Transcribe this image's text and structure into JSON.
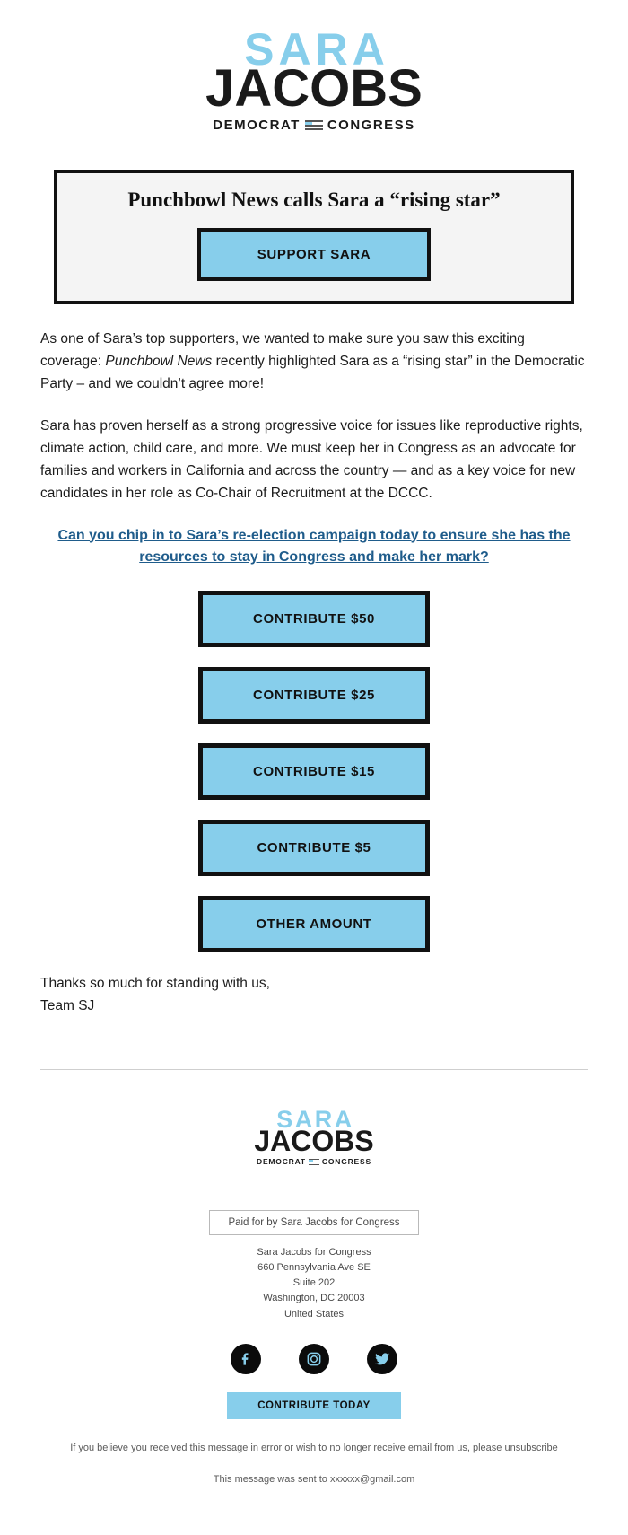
{
  "logo": {
    "first_name": "SARA",
    "last_name": "JACOBS",
    "tagline_left": "DEMOCRAT",
    "tagline_right": "CONGRESS",
    "icon": "flag-mark-icon",
    "accent_color": "#87CEEB",
    "dark_color": "#1a1a1a"
  },
  "hero": {
    "headline": "Punchbowl News calls Sara a “rising star”",
    "cta_label": "SUPPORT SARA"
  },
  "body": {
    "paragraph1_part1": "As one of Sara’s top supporters, we wanted to make sure you saw this exciting coverage: ",
    "paragraph1_italic": "Punchbowl News",
    "paragraph1_part2": " recently highlighted Sara as a “rising star” in the Democratic Party – and we couldn’t agree more!",
    "paragraph2": "Sara has proven herself as a strong progressive voice for issues like reproductive rights, climate action, child care, and more. We must keep her in Congress as an advocate for families and workers in California and across the country — and as a key voice for new candidates in her role as Co-Chair of Recruitment at the DCCC.",
    "cta_link": "Can you chip in to Sara’s re-election campaign today to ensure she has the resources to stay in Congress and make her mark?",
    "signoff_line1": "Thanks so much for standing with us,",
    "signoff_line2": "Team SJ"
  },
  "donate_buttons": [
    {
      "label": "CONTRIBUTE $50"
    },
    {
      "label": "CONTRIBUTE $25"
    },
    {
      "label": "CONTRIBUTE $15"
    },
    {
      "label": "CONTRIBUTE $5"
    },
    {
      "label": "OTHER AMOUNT"
    }
  ],
  "footer": {
    "paid_for": "Paid for by Sara Jacobs for Congress",
    "address": {
      "org": "Sara Jacobs for Congress",
      "street": "660 Pennsylvania Ave SE",
      "suite": "Suite 202",
      "city_state_zip": "Washington, DC 20003",
      "country": "United States"
    },
    "socials": [
      {
        "name": "facebook-icon"
      },
      {
        "name": "instagram-icon"
      },
      {
        "name": "twitter-icon"
      }
    ],
    "contribute_today": "CONTRIBUTE TODAY",
    "legal_part1": "If you believe you received this message in error or wish to no longer receive email from us, please ",
    "legal_unsubscribe": "unsubscribe",
    "sent_to": "This message was sent to xxxxxx@gmail.com"
  }
}
